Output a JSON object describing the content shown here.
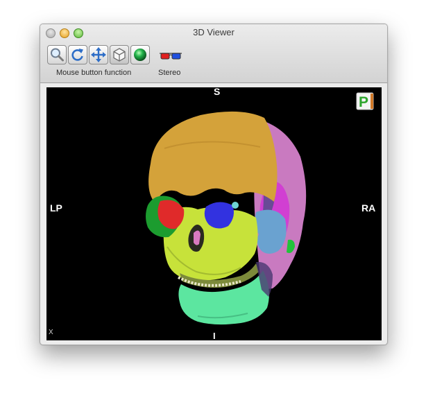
{
  "window": {
    "title": "3D Viewer"
  },
  "toolbar": {
    "tools": [
      {
        "name": "zoom",
        "icon": "magnifier-icon"
      },
      {
        "name": "rotate",
        "icon": "rotate-icon"
      },
      {
        "name": "pan",
        "icon": "move-arrows-icon"
      },
      {
        "name": "orient",
        "icon": "cube-icon"
      },
      {
        "name": "render",
        "icon": "green-sphere-icon"
      }
    ],
    "mouse_label": "Mouse button function",
    "stereo_icon": "3d-glasses-icon",
    "stereo_label": "Stereo"
  },
  "viewport": {
    "orientation": {
      "top": "S",
      "bottom": "I",
      "left": "LP",
      "right": "RA"
    },
    "corner_label": "X",
    "corner_icon": "p-badge-icon",
    "background": "#000000"
  },
  "colors": {
    "skull_cranium": "#d4a23a",
    "skull_face": "#c7e23a",
    "mandible": "#5ce6a0",
    "temporal": "#d04cd0",
    "zygoma": "#6aa2d0",
    "orbit_left": "#e02a2a",
    "orbit_right": "#3232e0",
    "maxilla": "#d97ac0"
  }
}
